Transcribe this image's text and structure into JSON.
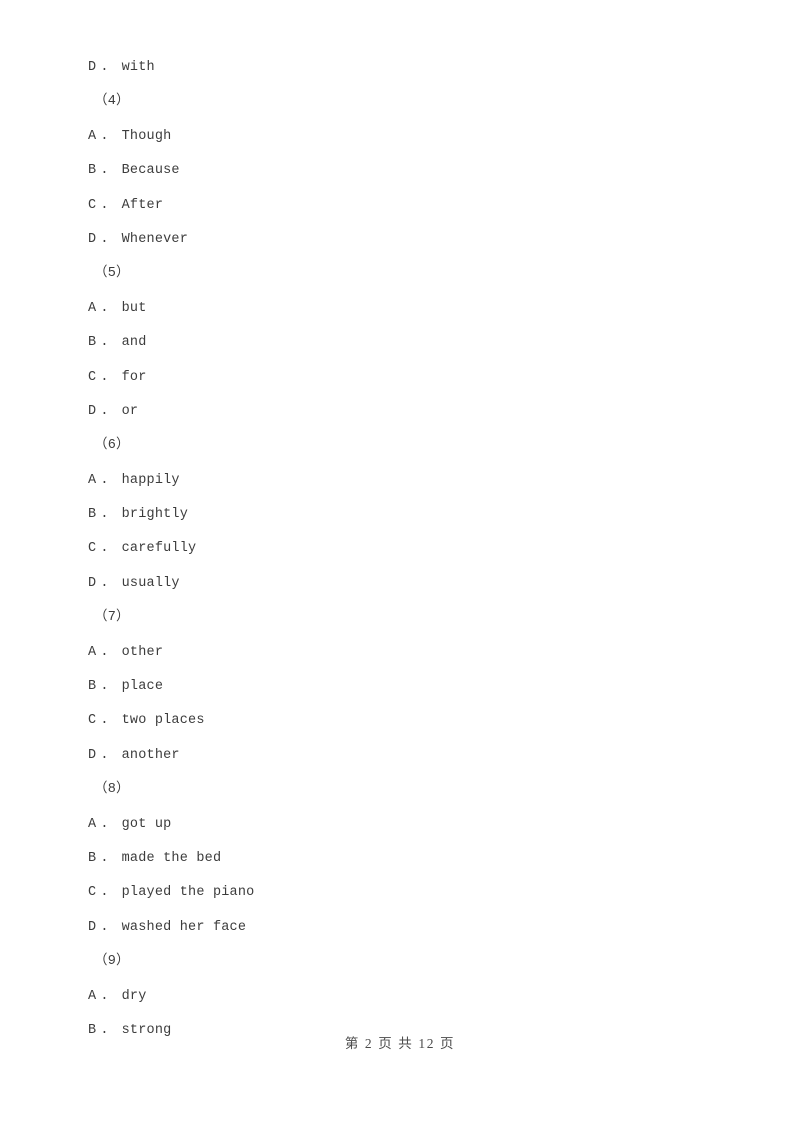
{
  "document": {
    "type": "exam-paper",
    "text_color": "#3c3c3c",
    "background_color": "#ffffff"
  },
  "lines": [
    {
      "kind": "option",
      "letter": "D",
      "dot": ".",
      "text": "with"
    },
    {
      "kind": "question",
      "label": "（4）"
    },
    {
      "kind": "option",
      "letter": "A",
      "dot": ".",
      "text": "Though"
    },
    {
      "kind": "option",
      "letter": "B",
      "dot": ".",
      "text": "Because"
    },
    {
      "kind": "option",
      "letter": "C",
      "dot": ".",
      "text": "After"
    },
    {
      "kind": "option",
      "letter": "D",
      "dot": ".",
      "text": "Whenever"
    },
    {
      "kind": "question",
      "label": "（5）"
    },
    {
      "kind": "option",
      "letter": "A",
      "dot": ".",
      "text": "but"
    },
    {
      "kind": "option",
      "letter": "B",
      "dot": ".",
      "text": "and"
    },
    {
      "kind": "option",
      "letter": "C",
      "dot": ".",
      "text": "for"
    },
    {
      "kind": "option",
      "letter": "D",
      "dot": ".",
      "text": "or"
    },
    {
      "kind": "question",
      "label": "（6）"
    },
    {
      "kind": "option",
      "letter": "A",
      "dot": ".",
      "text": "happily"
    },
    {
      "kind": "option",
      "letter": "B",
      "dot": ".",
      "text": "brightly"
    },
    {
      "kind": "option",
      "letter": "C",
      "dot": ".",
      "text": "carefully"
    },
    {
      "kind": "option",
      "letter": "D",
      "dot": ".",
      "text": "usually"
    },
    {
      "kind": "question",
      "label": "（7）"
    },
    {
      "kind": "option",
      "letter": "A",
      "dot": ".",
      "text": "other"
    },
    {
      "kind": "option",
      "letter": "B",
      "dot": ".",
      "text": "place"
    },
    {
      "kind": "option",
      "letter": "C",
      "dot": ".",
      "text": "two places"
    },
    {
      "kind": "option",
      "letter": "D",
      "dot": ".",
      "text": "another"
    },
    {
      "kind": "question",
      "label": "（8）"
    },
    {
      "kind": "option",
      "letter": "A",
      "dot": ".",
      "text": "got up"
    },
    {
      "kind": "option",
      "letter": "B",
      "dot": ".",
      "text": "made the bed"
    },
    {
      "kind": "option",
      "letter": "C",
      "dot": ".",
      "text": "played the piano"
    },
    {
      "kind": "option",
      "letter": "D",
      "dot": ".",
      "text": "washed her face"
    },
    {
      "kind": "question",
      "label": "（9）"
    },
    {
      "kind": "option",
      "letter": "A",
      "dot": ".",
      "text": "dry"
    },
    {
      "kind": "option",
      "letter": "B",
      "dot": ".",
      "text": "strong"
    }
  ],
  "footer": {
    "text": "第 2 页 共 12 页",
    "current_page": "2",
    "total_pages": "12"
  }
}
